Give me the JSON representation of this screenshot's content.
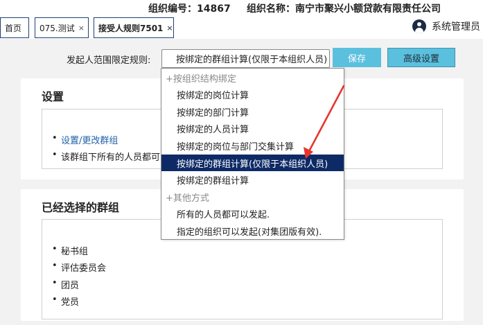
{
  "header": {
    "org_code": "组织编号：14867",
    "org_name": "组织名称：南宁市聚兴小额贷款有限责任公司"
  },
  "tabs": [
    {
      "label": "首页",
      "closable": false
    },
    {
      "label": "075.测试",
      "closable": true
    },
    {
      "label": "接受人规则7501",
      "closable": true
    }
  ],
  "tab_close_glyph": "×",
  "user": {
    "name": "系统管理员",
    "icon": "user-avatar-icon"
  },
  "toolbar": {
    "rule_label": "发起人范围限定规则:",
    "rule_value": "按绑定的群组计算(仅限于本组织人员)",
    "save_label": "保存",
    "advanced_label": "高级设置"
  },
  "settings_panel": {
    "title": "设置",
    "items": [
      "设置/更改群组",
      "该群组下所有的人员都可以发起"
    ]
  },
  "groups_panel": {
    "title": "已经选择的群组",
    "items": [
      "秘书组",
      "评估委员会",
      "团员",
      "党员"
    ]
  },
  "dropdown": {
    "options": [
      {
        "label": "+按组织结构绑定",
        "group": true
      },
      {
        "label": "按绑定的岗位计算",
        "group": false
      },
      {
        "label": "按绑定的部门计算",
        "group": false
      },
      {
        "label": "按绑定的人员计算",
        "group": false
      },
      {
        "label": "按绑定的岗位与部门交集计算",
        "group": false
      },
      {
        "label": "按绑定的群组计算(仅限于本组织人员)",
        "group": false,
        "selected": true
      },
      {
        "label": "按绑定的群组计算",
        "group": false
      },
      {
        "label": "+其他方式",
        "group": true
      },
      {
        "label": "所有的人员都可以发起.",
        "group": false
      },
      {
        "label": "指定的组织可以发起(对集团版有效).",
        "group": false
      }
    ]
  },
  "colors": {
    "accent": "#5bc0de",
    "selected_option": "#0e2a66",
    "annotation_arrow": "#e8342b"
  }
}
